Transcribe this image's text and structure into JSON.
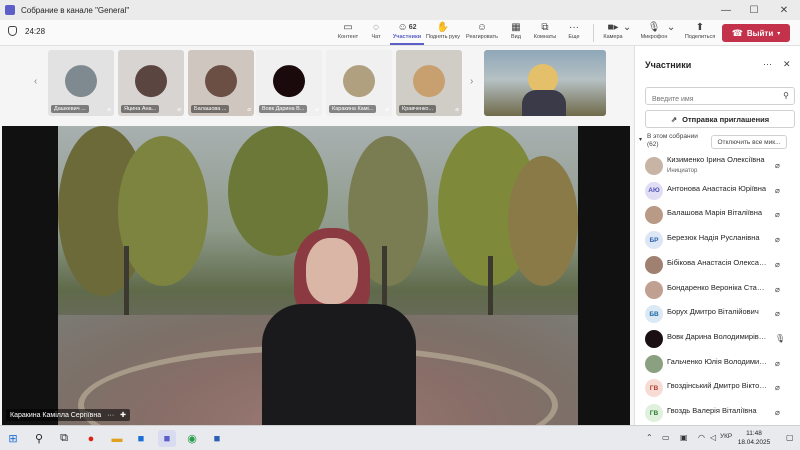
{
  "window": {
    "title": "Собрание в канале \"General\""
  },
  "toolbar": {
    "timer": "24:28",
    "participants_count": "62",
    "buttons": [
      {
        "id": "content",
        "label": "Контент",
        "icon": "share-screen-icon"
      },
      {
        "id": "chat",
        "label": "Чат",
        "icon": "chat-icon"
      },
      {
        "id": "participants",
        "label": "Участники",
        "icon": "people-icon"
      },
      {
        "id": "raise",
        "label": "Поднять руку",
        "icon": "hand-icon"
      },
      {
        "id": "react",
        "label": "Реагировать",
        "icon": "smile-icon"
      },
      {
        "id": "view",
        "label": "Вид",
        "icon": "grid-icon"
      },
      {
        "id": "rooms",
        "label": "Комнаты",
        "icon": "rooms-icon"
      },
      {
        "id": "more",
        "label": "Еще",
        "icon": "more-icon"
      },
      {
        "id": "camera",
        "label": "Камера",
        "icon": "camera-icon"
      },
      {
        "id": "mic",
        "label": "Микрофон",
        "icon": "mic-muted-icon"
      },
      {
        "id": "share",
        "label": "Поделиться",
        "icon": "share-icon"
      }
    ],
    "leave_label": "Выйти"
  },
  "gallery": [
    {
      "name": "Дашкевич ..."
    },
    {
      "name": "Яцина Ана..."
    },
    {
      "name": "Балашова ..."
    },
    {
      "name": "Вовк Дарина В..."
    },
    {
      "name": "Каракина Камі..."
    },
    {
      "name": "Кравченко..."
    }
  ],
  "main_video": {
    "speaker": "Каракина Камілла Сергіївна"
  },
  "panel": {
    "title": "Участники",
    "search_placeholder": "Введите имя",
    "invite_label": "Отправка приглашения",
    "section_line1": "В этом собрании",
    "section_line2": "(62)",
    "mute_all_label": "Отключить все мик...",
    "participants": [
      {
        "name": "Кизименко Ірина Олексіївна",
        "role": "Инициатор",
        "initials": "",
        "bg": "#c8b4a4",
        "mic": "muted"
      },
      {
        "name": "Антонова Анастасія Юріївна",
        "role": "",
        "initials": "АЮ",
        "bg": "#e0ddf5",
        "color": "#4f52b2",
        "mic": "muted"
      },
      {
        "name": "Балашова Марія Віталіївна",
        "role": "",
        "initials": "",
        "bg": "#b89a86",
        "mic": "muted"
      },
      {
        "name": "Березюк Надія Русланівна",
        "role": "",
        "initials": "БР",
        "bg": "#dde6f5",
        "color": "#2b62b0",
        "mic": "muted"
      },
      {
        "name": "Бібікова Анастасія Олександ...",
        "role": "",
        "initials": "",
        "bg": "#a08070",
        "mic": "muted"
      },
      {
        "name": "Бондаренко Вероніка Станіс...",
        "role": "",
        "initials": "",
        "bg": "#c0a090",
        "mic": "muted"
      },
      {
        "name": "Борух Дмитро Віталійович",
        "role": "",
        "initials": "БВ",
        "bg": "#dbe9f5",
        "color": "#1e6aa8",
        "mic": "muted"
      },
      {
        "name": "Вовк Дарина Володимирівна",
        "role": "",
        "initials": "",
        "bg": "#1a1014",
        "mic": "on"
      },
      {
        "name": "Гальченко Юлія Володимирі...",
        "role": "",
        "initials": "",
        "bg": "#8aa080",
        "mic": "muted"
      },
      {
        "name": "Гвоздінський Дмитро Віктор...",
        "role": "",
        "initials": "ГВ",
        "bg": "#f7dcd6",
        "color": "#b0402e",
        "mic": "muted"
      },
      {
        "name": "Гвоздь Валерія Віталіївна",
        "role": "",
        "initials": "ГВ",
        "bg": "#dff0dc",
        "color": "#2e7d32",
        "mic": "muted"
      }
    ]
  },
  "taskbar": {
    "lang": "УКР",
    "time": "11:48",
    "date": "18.04.2025"
  }
}
